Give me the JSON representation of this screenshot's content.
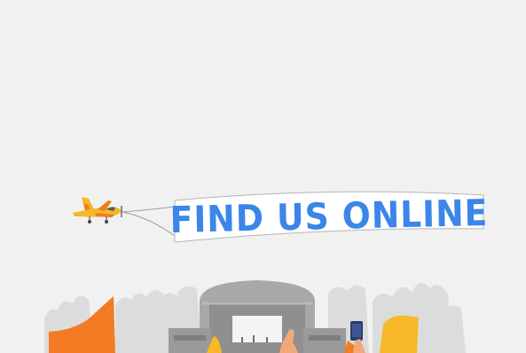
{
  "banner": {
    "text": "FIND US ONLINE"
  },
  "colors": {
    "background": "#f1f1f1",
    "banner_text": "#3b86e8",
    "plane_body": "#f6b629",
    "plane_accent": "#f07d22",
    "stage_gray": "#a6a6a6",
    "crowd_orange": "#f27b24",
    "crowd_yellow": "#f7b928",
    "skin": "#f2a97a",
    "phone_navy": "#2d3b6b"
  },
  "icons": [
    "airplane-icon",
    "festival-stage-icon",
    "smartphone-icon"
  ]
}
